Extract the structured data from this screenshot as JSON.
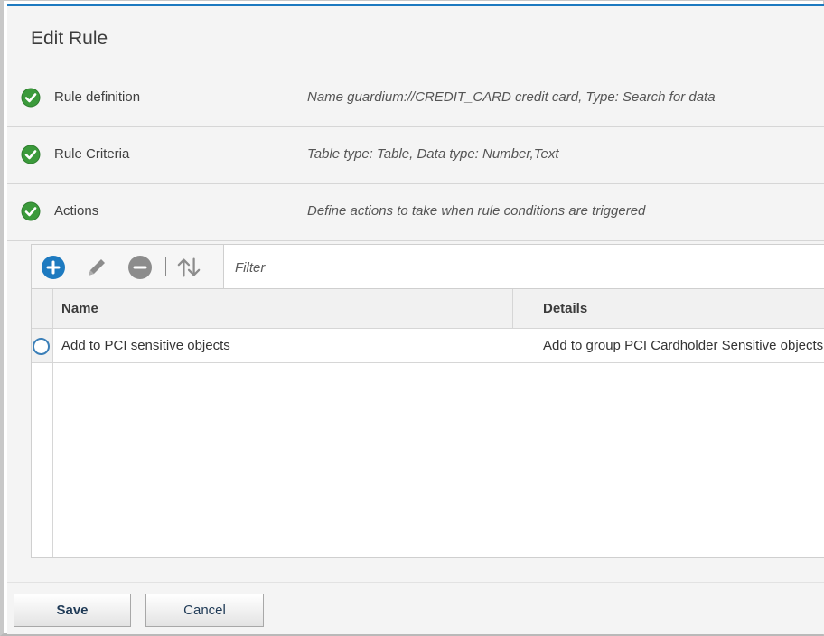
{
  "dialog": {
    "title": "Edit Rule"
  },
  "sections": [
    {
      "label": "Rule definition",
      "description": "Name guardium://CREDIT_CARD credit card, Type: Search for data",
      "status_icon": "check-circle-icon"
    },
    {
      "label": "Rule Criteria",
      "description": "Table type: Table, Data type: Number,Text",
      "status_icon": "check-circle-icon"
    },
    {
      "label": "Actions",
      "description": "Define actions to take when rule conditions are triggered",
      "status_icon": "check-circle-icon"
    }
  ],
  "toolbar": {
    "icons": [
      "add-icon",
      "edit-pencil-icon",
      "remove-icon",
      "sort-icon"
    ]
  },
  "filter": {
    "placeholder": "Filter",
    "value": ""
  },
  "table": {
    "columns": [
      "Name",
      "Details"
    ],
    "rows": [
      {
        "name": "Add to PCI sensitive objects",
        "details": "Add to group PCI Cardholder Sensitive objects"
      }
    ]
  },
  "footer": {
    "save_label": "Save",
    "cancel_label": "Cancel"
  },
  "colors": {
    "accent": "#1d7ac0",
    "success": "#3b9a3b",
    "disabled_icon": "#8c8c8c"
  }
}
